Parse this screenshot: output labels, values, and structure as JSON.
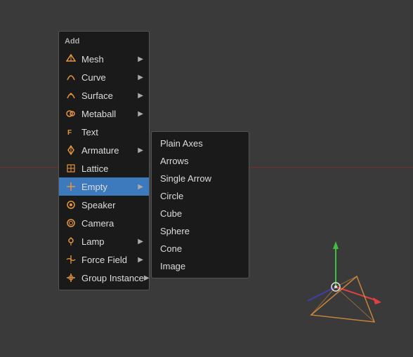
{
  "viewport": {
    "background": "#3a3a3a"
  },
  "menu": {
    "title": "Add",
    "items": [
      {
        "label": "Mesh",
        "has_arrow": true,
        "icon": "mesh"
      },
      {
        "label": "Curve",
        "has_arrow": true,
        "icon": "curve"
      },
      {
        "label": "Surface",
        "has_arrow": true,
        "icon": "surface"
      },
      {
        "label": "Metaball",
        "has_arrow": true,
        "icon": "metaball"
      },
      {
        "label": "Text",
        "has_arrow": false,
        "icon": "text"
      },
      {
        "label": "Armature",
        "has_arrow": true,
        "icon": "armature"
      },
      {
        "label": "Lattice",
        "has_arrow": false,
        "icon": "lattice"
      },
      {
        "label": "Empty",
        "has_arrow": true,
        "icon": "empty",
        "active": true
      },
      {
        "label": "Speaker",
        "has_arrow": false,
        "icon": "speaker"
      },
      {
        "label": "Camera",
        "has_arrow": false,
        "icon": "camera"
      },
      {
        "label": "Lamp",
        "has_arrow": true,
        "icon": "lamp"
      },
      {
        "label": "Force Field",
        "has_arrow": true,
        "icon": "forcefield"
      },
      {
        "label": "Group Instance",
        "has_arrow": true,
        "icon": "groupinstance"
      }
    ]
  },
  "submenu": {
    "items": [
      {
        "label": "Plain Axes"
      },
      {
        "label": "Arrows"
      },
      {
        "label": "Single Arrow"
      },
      {
        "label": "Circle"
      },
      {
        "label": "Cube"
      },
      {
        "label": "Sphere"
      },
      {
        "label": "Cone"
      },
      {
        "label": "Image"
      }
    ]
  },
  "axes": {
    "x_color": "#e04040",
    "y_color": "#40c040",
    "z_color": "#4040e0"
  }
}
